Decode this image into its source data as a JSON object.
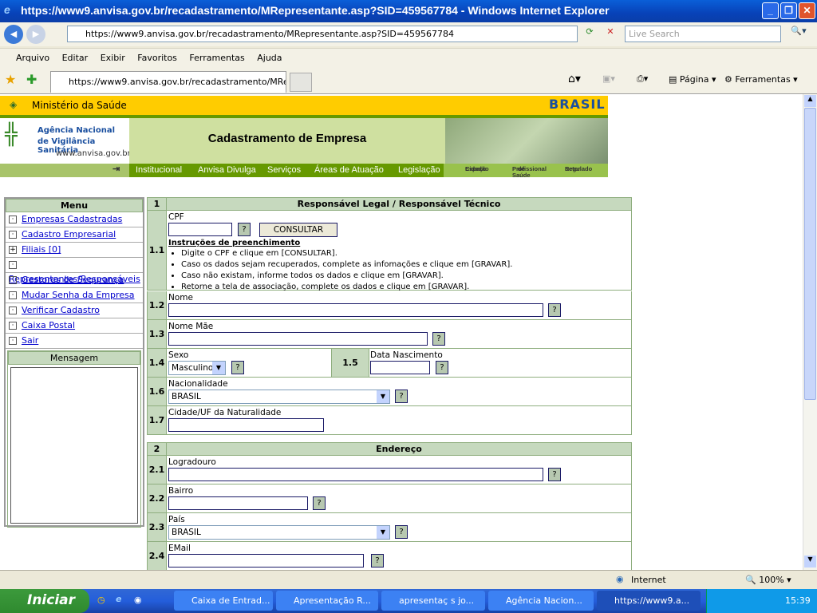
{
  "window": {
    "title": "https://www9.anvisa.gov.br/recadastramento/MRepresentante.asp?SID=459567784 - Windows Internet Explorer",
    "url": "https://www9.anvisa.gov.br/recadastramento/MRepresentante.asp?SID=459567784",
    "search_placeholder": "Live Search",
    "tab_title": "https://www9.anvisa.gov.br/recadastramento/MRepr...",
    "pagina": "Página",
    "ferramentas": "Ferramentas"
  },
  "menubar": [
    "Arquivo",
    "Editar",
    "Exibir",
    "Favoritos",
    "Ferramentas",
    "Ajuda"
  ],
  "site": {
    "ministerio": "Ministério da Saúde",
    "brasil": "BRASIL",
    "agency1": "Agência Nacional",
    "agency2": "de Vigilância Sanitária",
    "agency_url": "www.anvisa.gov.br",
    "title": "Cadastramento de Empresa",
    "nav": [
      "Institucional",
      "Anvisa Divulga",
      "Serviços",
      "Áreas de Atuação",
      "Legislação"
    ],
    "nav_right": [
      [
        "Espaço",
        "Cidadão"
      ],
      [
        "Profissional",
        "de Saúde"
      ],
      [
        "Setor",
        "Regulado"
      ]
    ]
  },
  "menu": {
    "title": "Menu",
    "items": [
      {
        "label": "Empresas Cadastradas",
        "box": "·"
      },
      {
        "label": "Cadastro Empresarial",
        "box": "·"
      },
      {
        "label": "Filiais [0]",
        "box": "+"
      },
      {
        "label": "Representantes/Responsáveis",
        "box": "·"
      },
      {
        "label": "Gestores de Sequrança",
        "box": "·"
      },
      {
        "label": "Mudar Senha da Empresa",
        "box": "·"
      },
      {
        "label": "Verificar Cadastro",
        "box": "·"
      },
      {
        "label": "Caixa Postal",
        "box": "·"
      },
      {
        "label": "Sair",
        "box": "·"
      }
    ],
    "mensagem": "Mensagem"
  },
  "form": {
    "s1": {
      "num": "1",
      "title": "Responsável Legal / Responsável Técnico"
    },
    "cpf": {
      "num": "1.1",
      "label": "CPF",
      "value": "",
      "help": "?",
      "consultar": "CONSULTAR",
      "instr_title": "Instruções de preenchimento",
      "instr": [
        "Digite o CPF e clique em [CONSULTAR].",
        "Caso os dados sejam recuperados, complete as infomações e clique em [GRAVAR].",
        "Caso não existam, informe todos os dados e clique em [GRAVAR].",
        "Retorne a tela de associação, complete os dados e clique em [GRAVAR]."
      ]
    },
    "nome": {
      "num": "1.2",
      "label": "Nome",
      "value": ""
    },
    "mae": {
      "num": "1.3",
      "label": "Nome Mãe",
      "value": ""
    },
    "sexo": {
      "num": "1.4",
      "label": "Sexo",
      "value": "Masculino"
    },
    "nasc": {
      "num": "1.5",
      "label": "Data Nascimento",
      "value": ""
    },
    "nac": {
      "num": "1.6",
      "label": "Nacionalidade",
      "value": "BRASIL"
    },
    "nat": {
      "num": "1.7",
      "label": "Cidade/UF da Naturalidade",
      "value": ""
    },
    "s2": {
      "num": "2",
      "title": "Endereço"
    },
    "logr": {
      "num": "2.1",
      "label": "Logradouro",
      "value": ""
    },
    "bairro": {
      "num": "2.2",
      "label": "Bairro",
      "value": ""
    },
    "pais": {
      "num": "2.3",
      "label": "País",
      "value": "BRASIL"
    },
    "email": {
      "num": "2.4",
      "label": "EMail",
      "value": ""
    }
  },
  "status": {
    "zone": "Internet",
    "zoom": "100%"
  },
  "taskbar": {
    "start": "Iniciar",
    "items": [
      "Caixa de Entrad...",
      "Apresentação R...",
      "apresentaç s jo...",
      "Agência Nacion...",
      "https://www9.a..."
    ],
    "clock": "15:39"
  }
}
